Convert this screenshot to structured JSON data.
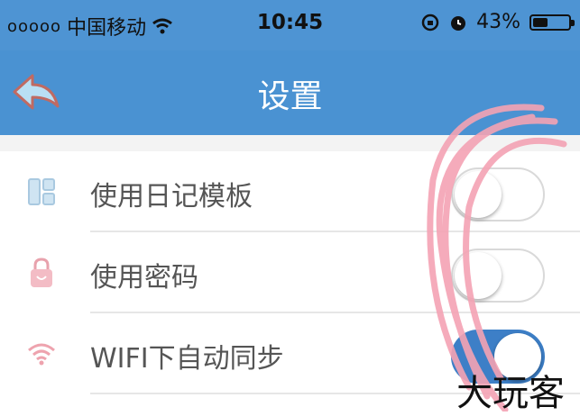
{
  "status_bar": {
    "carrier_dots": "ooooo",
    "carrier": "中国移动",
    "wifi_icon": "wifi-icon",
    "time": "10:45",
    "battery_percent": "43%",
    "battery_level": 0.43
  },
  "nav": {
    "title": "设置",
    "back_icon": "back-arrow-icon"
  },
  "settings": [
    {
      "label": "使用日记模板",
      "icon": "template-icon",
      "enabled": false
    },
    {
      "label": "使用密码",
      "icon": "lock-icon",
      "enabled": false
    },
    {
      "label": "WIFI下自动同步",
      "icon": "wifi-icon",
      "enabled": true
    }
  ],
  "watermark": "大玩客",
  "colors": {
    "nav_bg": "#4a92d2",
    "toggle_on": "#3d7fc7",
    "highlight_circle": "#f4a3b4"
  }
}
